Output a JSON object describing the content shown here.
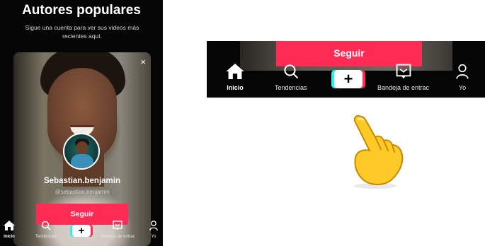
{
  "screen_left": {
    "heading": "Autores populares",
    "subtitle": "Sigue una cuenta para ver sus videos más recientes aquí.",
    "close_symbol": "×",
    "profile": {
      "username": "Sebastian.benjamin",
      "handle": "@sebastian.benjamin"
    },
    "follow_label": "Seguir"
  },
  "nav": {
    "home_label": "Inicio",
    "discover_label": "Tendencias",
    "create_symbol": "+",
    "inbox_label": "Bandeja de entrac",
    "profile_label": "Yo"
  },
  "zoom_panel": {
    "follow_label": "Seguir"
  },
  "icons": {
    "home": "home-icon",
    "search": "search-icon",
    "create": "plus-icon",
    "inbox": "inbox-icon",
    "profile": "person-icon",
    "pointer": "pointing-hand-icon"
  },
  "colors": {
    "accent": "#fe2c55",
    "cyan": "#25f4ee",
    "background": "#050505"
  }
}
